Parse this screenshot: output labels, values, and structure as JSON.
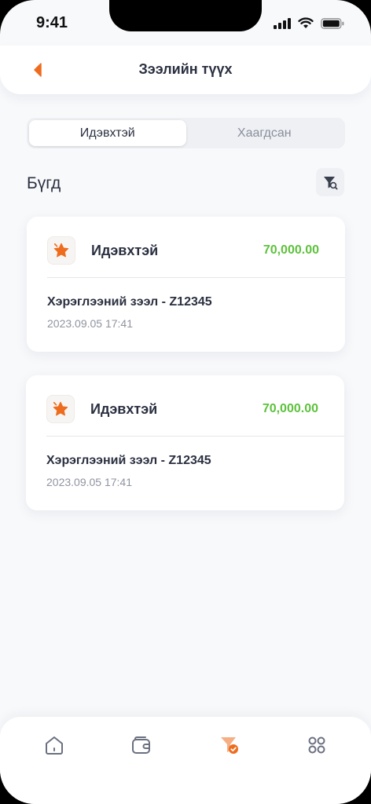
{
  "status_bar": {
    "time": "9:41"
  },
  "header": {
    "title": "Зээлийн түүх"
  },
  "tabs": [
    {
      "label": "Идэвхтэй",
      "active": true
    },
    {
      "label": "Хаагдсан",
      "active": false
    }
  ],
  "section": {
    "title": "Бүгд"
  },
  "loans": [
    {
      "status": "Идэвхтэй",
      "amount": "70,000.00",
      "name": "Хэрэглээний зээл - Z12345",
      "date": "2023.09.05 17:41"
    },
    {
      "status": "Идэвхтэй",
      "amount": "70,000.00",
      "name": "Хэрэглээний зээл - Z12345",
      "date": "2023.09.05 17:41"
    }
  ],
  "colors": {
    "accent": "#EE6C1E",
    "amount": "#5DC23C",
    "icon_grey": "#6B7080"
  },
  "bottom_nav": [
    {
      "icon": "home-icon",
      "active": false
    },
    {
      "icon": "wallet-icon",
      "active": false
    },
    {
      "icon": "funnel-check-icon",
      "active": true
    },
    {
      "icon": "grid-icon",
      "active": false
    }
  ]
}
